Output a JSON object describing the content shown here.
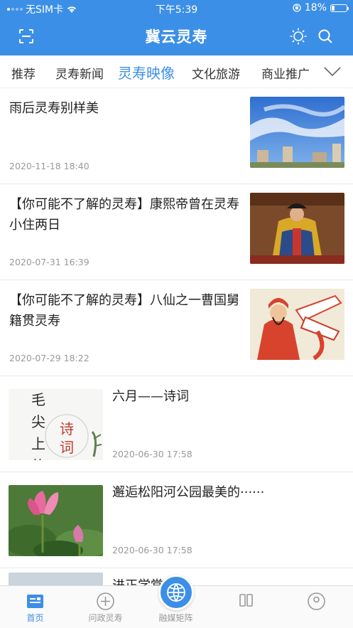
{
  "status_bar": {
    "carrier": "无SIM卡",
    "time": "下午5:39",
    "battery": "18%",
    "battery_level": 0.18
  },
  "header": {
    "title": "冀云灵寿",
    "icons": [
      "scan-icon",
      "brightness-icon",
      "search-icon"
    ]
  },
  "tabs": {
    "items": [
      "推荐",
      "灵寿新闻",
      "灵寿映像",
      "文化旅游",
      "商业推广"
    ],
    "active": "灵寿映像"
  },
  "feed": {
    "items": [
      {
        "title": "雨后灵寿别样美",
        "date": "2020-11-18 18:40",
        "thumb": "sky-buildings-photo"
      },
      {
        "title": "【你可能不了解的灵寿】康熙帝曾在灵寿小住两日",
        "date": "2020-07-31 16:39",
        "thumb": "emperor-portrait"
      },
      {
        "title": "【你可能不了解的灵寿】八仙之一曹国舅籍贯灵寿",
        "date": "2020-07-29 18:22",
        "thumb": "immortal-painting"
      },
      {
        "title": "六月——诗词",
        "date": "2020-06-30 17:58",
        "thumb": "calligraphy-image",
        "thumb_text": "毛尖上的诗词"
      },
      {
        "title": "邂逅松阳河公园最美的······",
        "date": "2020-06-30 17:58",
        "thumb": "lotus-photo"
      },
      {
        "title": "进正学堂旧址"
      }
    ]
  },
  "bottom_nav": {
    "items": [
      "首页",
      "问政灵寿",
      "融媒矩阵",
      "",
      ""
    ],
    "active": "首页"
  },
  "colors": {
    "brand": "#3c8fe6",
    "muted": "#999999"
  }
}
